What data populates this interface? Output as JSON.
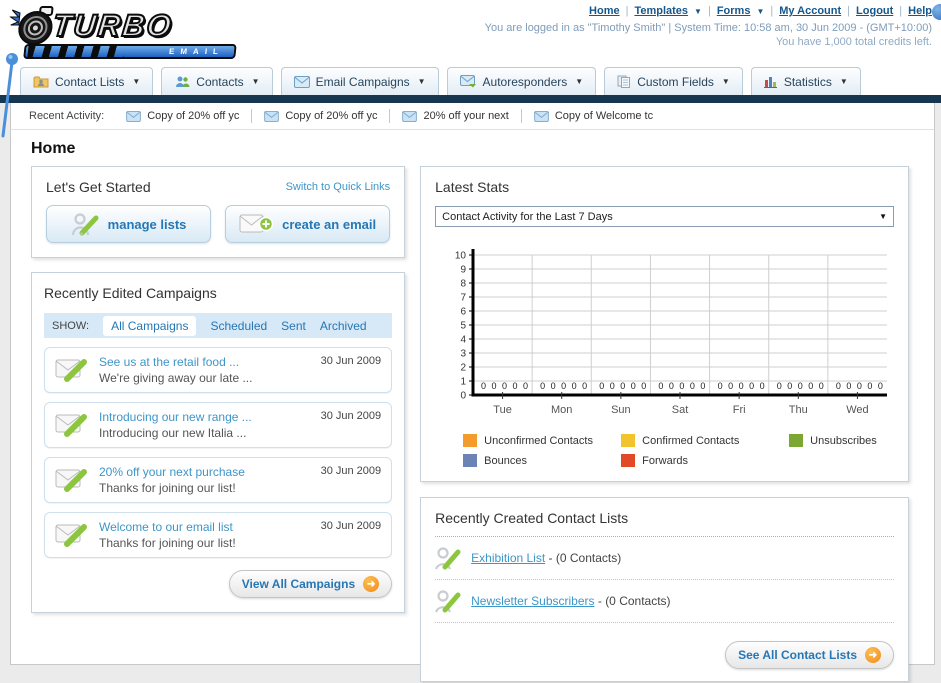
{
  "logo": {
    "line1": "TURBO",
    "line2": "EMAIL"
  },
  "header": {
    "links": [
      {
        "label": "Home",
        "has_menu": false
      },
      {
        "label": "Templates",
        "has_menu": true
      },
      {
        "label": "Forms",
        "has_menu": true
      },
      {
        "label": "My Account",
        "has_menu": false
      },
      {
        "label": "Logout",
        "has_menu": false
      },
      {
        "label": "Help",
        "has_menu": false
      }
    ],
    "login_info": "You are logged in as \"Timothy Smith\" | System Time: 10:58 am, 30 Jun 2009 - (GMT+10:00)",
    "credits_info": "You have 1,000 total credits left."
  },
  "nav": {
    "tabs": [
      {
        "label": "Contact Lists"
      },
      {
        "label": "Contacts"
      },
      {
        "label": "Email Campaigns"
      },
      {
        "label": "Autoresponders"
      },
      {
        "label": "Custom Fields"
      },
      {
        "label": "Statistics"
      }
    ],
    "caret": "▼"
  },
  "recent_activity": {
    "label": "Recent Activity:",
    "items": [
      "Copy of 20% off yc",
      "Copy of 20% off yc",
      "20% off your next",
      "Copy of Welcome tc"
    ]
  },
  "page": {
    "title": "Home"
  },
  "get_started": {
    "title": "Let's Get Started",
    "switch_link": "Switch to Quick Links",
    "manage_lists_label": "manage lists",
    "create_email_label": "create an email"
  },
  "campaigns": {
    "title": "Recently Edited Campaigns",
    "show_label": "SHOW:",
    "filters": [
      "All Campaigns",
      "Scheduled",
      "Sent",
      "Archived"
    ],
    "active_filter": "All Campaigns",
    "items": [
      {
        "title": "See us at the retail food ...",
        "subtitle": "We're giving away our late ...",
        "date": "30 Jun 2009"
      },
      {
        "title": "Introducing our new range ...",
        "subtitle": "Introducing our new Italia ...",
        "date": "30 Jun 2009"
      },
      {
        "title": "20% off your next purchase",
        "subtitle": "Thanks for joining our list!",
        "date": "30 Jun 2009"
      },
      {
        "title": "Welcome to our email list",
        "subtitle": "Thanks for joining our list!",
        "date": "30 Jun 2009"
      }
    ],
    "view_all_label": "View All Campaigns"
  },
  "stats": {
    "title": "Latest Stats",
    "dropdown_value": "Contact Activity for the Last 7 Days"
  },
  "chart_data": {
    "type": "bar",
    "title": "Contact Activity for the Last 7 Days",
    "categories": [
      "Tue",
      "Mon",
      "Sun",
      "Sat",
      "Fri",
      "Thu",
      "Wed"
    ],
    "series": [
      {
        "name": "Unconfirmed Contacts",
        "color": "#F39C2C",
        "values": [
          0,
          0,
          0,
          0,
          0,
          0,
          0
        ]
      },
      {
        "name": "Confirmed Contacts",
        "color": "#F3C32B",
        "values": [
          0,
          0,
          0,
          0,
          0,
          0,
          0
        ]
      },
      {
        "name": "Unsubscribes",
        "color": "#7CA733",
        "values": [
          0,
          0,
          0,
          0,
          0,
          0,
          0
        ]
      },
      {
        "name": "Bounces",
        "color": "#6B83B5",
        "values": [
          0,
          0,
          0,
          0,
          0,
          0,
          0
        ]
      },
      {
        "name": "Forwards",
        "color": "#E04A26",
        "values": [
          0,
          0,
          0,
          0,
          0,
          0,
          0
        ]
      }
    ],
    "ylim": [
      0,
      10
    ],
    "ytick_step": 1,
    "grid": true,
    "legend_position": "bottom",
    "value_labels_shown": true
  },
  "contact_lists": {
    "title": "Recently Created Contact Lists",
    "items": [
      {
        "name": "Exhibition List",
        "count": "- (0 Contacts)"
      },
      {
        "name": "Newsletter Subscribers",
        "count": "- (0 Contacts)"
      }
    ],
    "see_all_label": "See All Contact Lists"
  },
  "colors": {
    "navy_bar": "#16374F",
    "link_blue": "#3D96C9",
    "button_text_blue": "#2577B5",
    "show_bar_bg": "#D7E8F7",
    "orange_accent": "#F28A17",
    "pencil_green": "#8CC63F"
  }
}
